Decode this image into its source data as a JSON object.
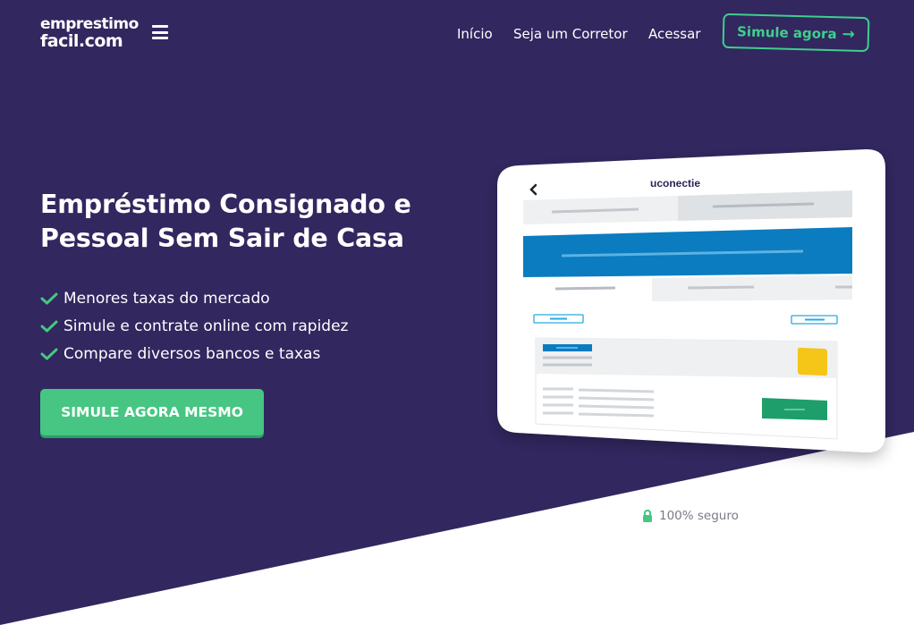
{
  "colors": {
    "hero_background": "#32275f",
    "accent_green": "#46c682",
    "outline_green": "#3fcf8e",
    "screen_blue": "#0a7cbf",
    "screen_yellow": "#f5c518",
    "screen_green_button": "#1e9e6a"
  },
  "header": {
    "logo_line1": "emprestimo",
    "logo_line2": "facil.com",
    "menu_icon": "hamburger-icon",
    "nav_items": [
      "Início",
      "Seja um Corretor",
      "Acessar"
    ],
    "cta_label": "Simule agora",
    "cta_icon": "arrow-right-icon"
  },
  "hero": {
    "headline_line1": "Empréstimo Consignado e",
    "headline_line2": "Pessoal Sem Sair de Casa",
    "bullets": [
      "Menores taxas do mercado",
      "Simule e contrate online com rapidez",
      "Compare diversos bancos e taxas"
    ],
    "bullet_icon": "check-icon",
    "cta_label": "SIMULE AGORA MESMO",
    "secure_icon": "lock-icon",
    "secure_label": "100% seguro"
  },
  "tablet_mockup": {
    "brand": "uconectie",
    "back_icon": "chevron-left-icon"
  }
}
